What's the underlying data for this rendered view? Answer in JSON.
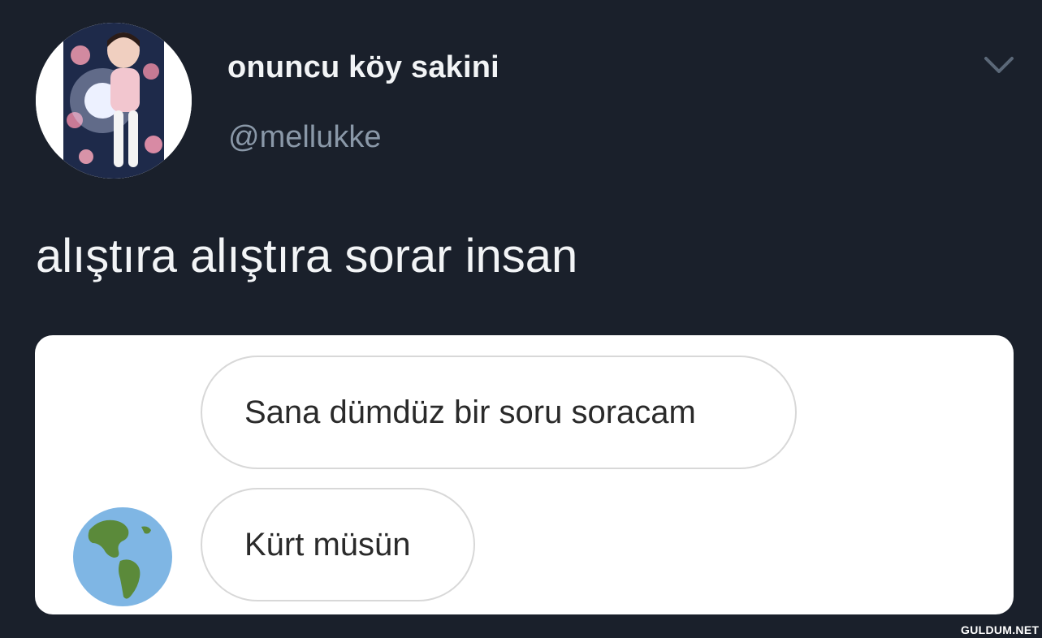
{
  "tweet": {
    "display_name": "onuncu köy sakini",
    "handle": "@mellukke",
    "text": "alıştıra alıştıra sorar insan",
    "menu_icon": "chevron-down-icon"
  },
  "chat_card": {
    "messages": [
      {
        "text": "Sana dümdüz bir soru soracam"
      },
      {
        "text": "Kürt müsün"
      }
    ],
    "sender_avatar_icon": "globe-americas-icon"
  },
  "watermark": "GULDUM.NET",
  "colors": {
    "background": "#1a202b",
    "primary_text": "#f2f4f6",
    "secondary_text": "#8a98a8",
    "card_background": "#ffffff",
    "bubble_border": "#d8d8d8"
  }
}
